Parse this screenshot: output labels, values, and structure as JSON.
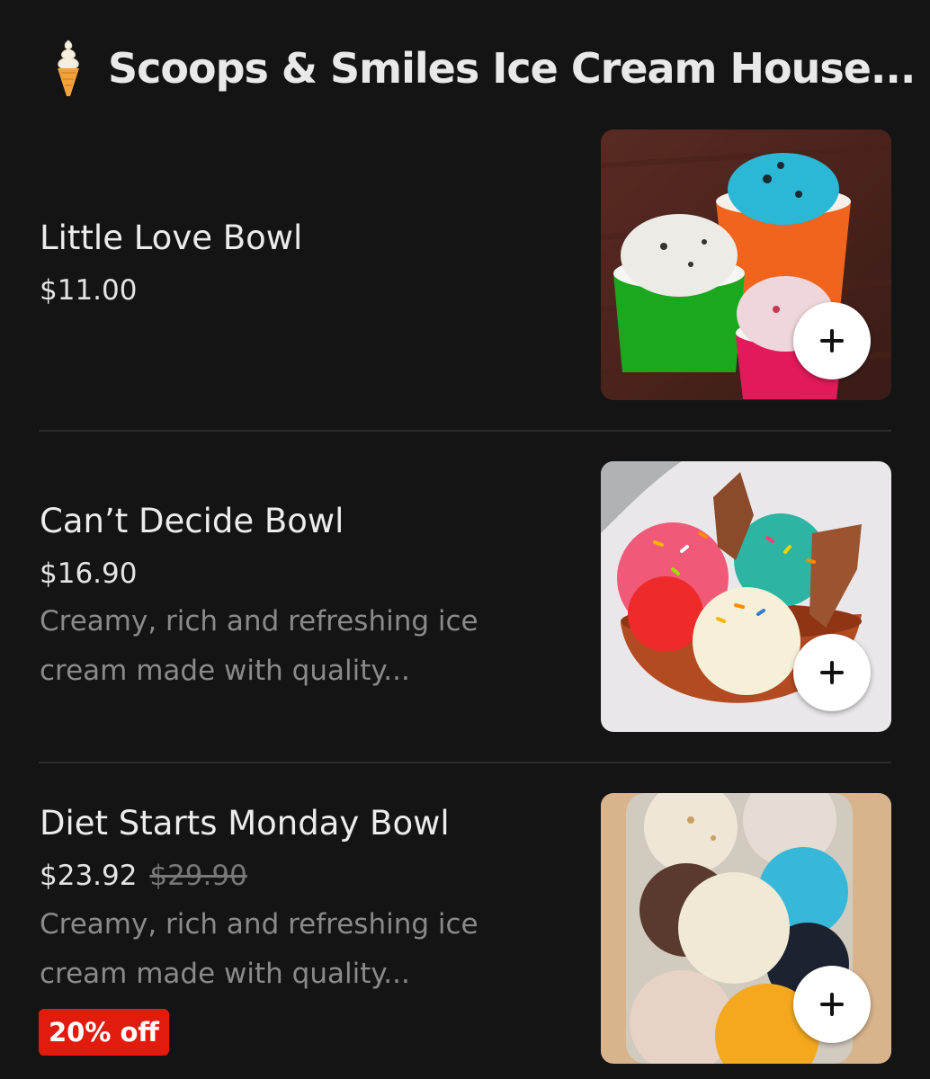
{
  "header": {
    "title": "Scoops & Smiles Ice Cream House...",
    "icon": "soft-serve-cone-icon"
  },
  "items": [
    {
      "name": "Little Love Bowl",
      "price": "$11.00"
    },
    {
      "name": "Can’t Decide Bowl",
      "price": "$16.90",
      "description_line1": "Creamy, rich and refreshing ice",
      "description_line2": "cream made with quality..."
    },
    {
      "name": "Diet Starts Monday Bowl",
      "price": "$23.92",
      "original_price": "$29.90",
      "description_line1": "Creamy, rich and refreshing ice",
      "description_line2": "cream made with quality...",
      "badge": "20% off"
    }
  ],
  "colors": {
    "background": "#141414",
    "badge": "#e11b0e",
    "add_button": "#ffffff"
  }
}
